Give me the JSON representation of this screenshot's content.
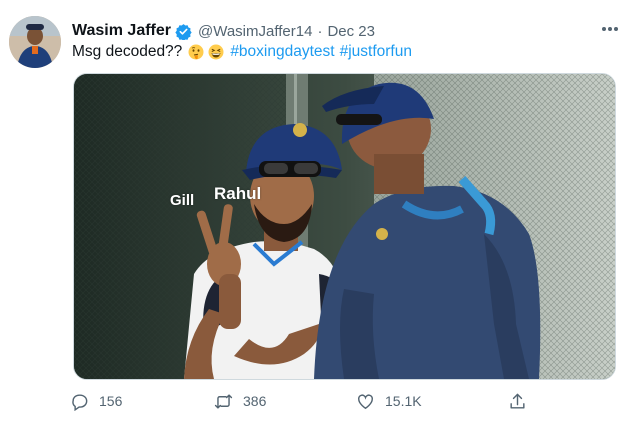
{
  "tweet": {
    "author_name": "Wasim Jaffer",
    "handle": "@WasimJaffer14",
    "separator": "·",
    "date": "Dec 23",
    "text": "Msg decoded??",
    "hashtags": [
      "#boxingdaytest",
      "#justforfun"
    ],
    "emojis": [
      "thinking-face-emoji",
      "grinning-squinting-face-emoji"
    ]
  },
  "media": {
    "overlay_labels": [
      "Gill",
      "Rahul"
    ]
  },
  "actions": {
    "reply_count": "156",
    "retweet_count": "386",
    "like_count": "15.1K"
  },
  "icons": {
    "verified": "verified-badge-icon",
    "more": "more-options-icon",
    "reply": "reply-icon",
    "retweet": "retweet-icon",
    "like": "like-icon",
    "share": "share-icon"
  },
  "colors": {
    "accent": "#1d9bf0",
    "text": "#0f1419",
    "muted": "#536471"
  }
}
